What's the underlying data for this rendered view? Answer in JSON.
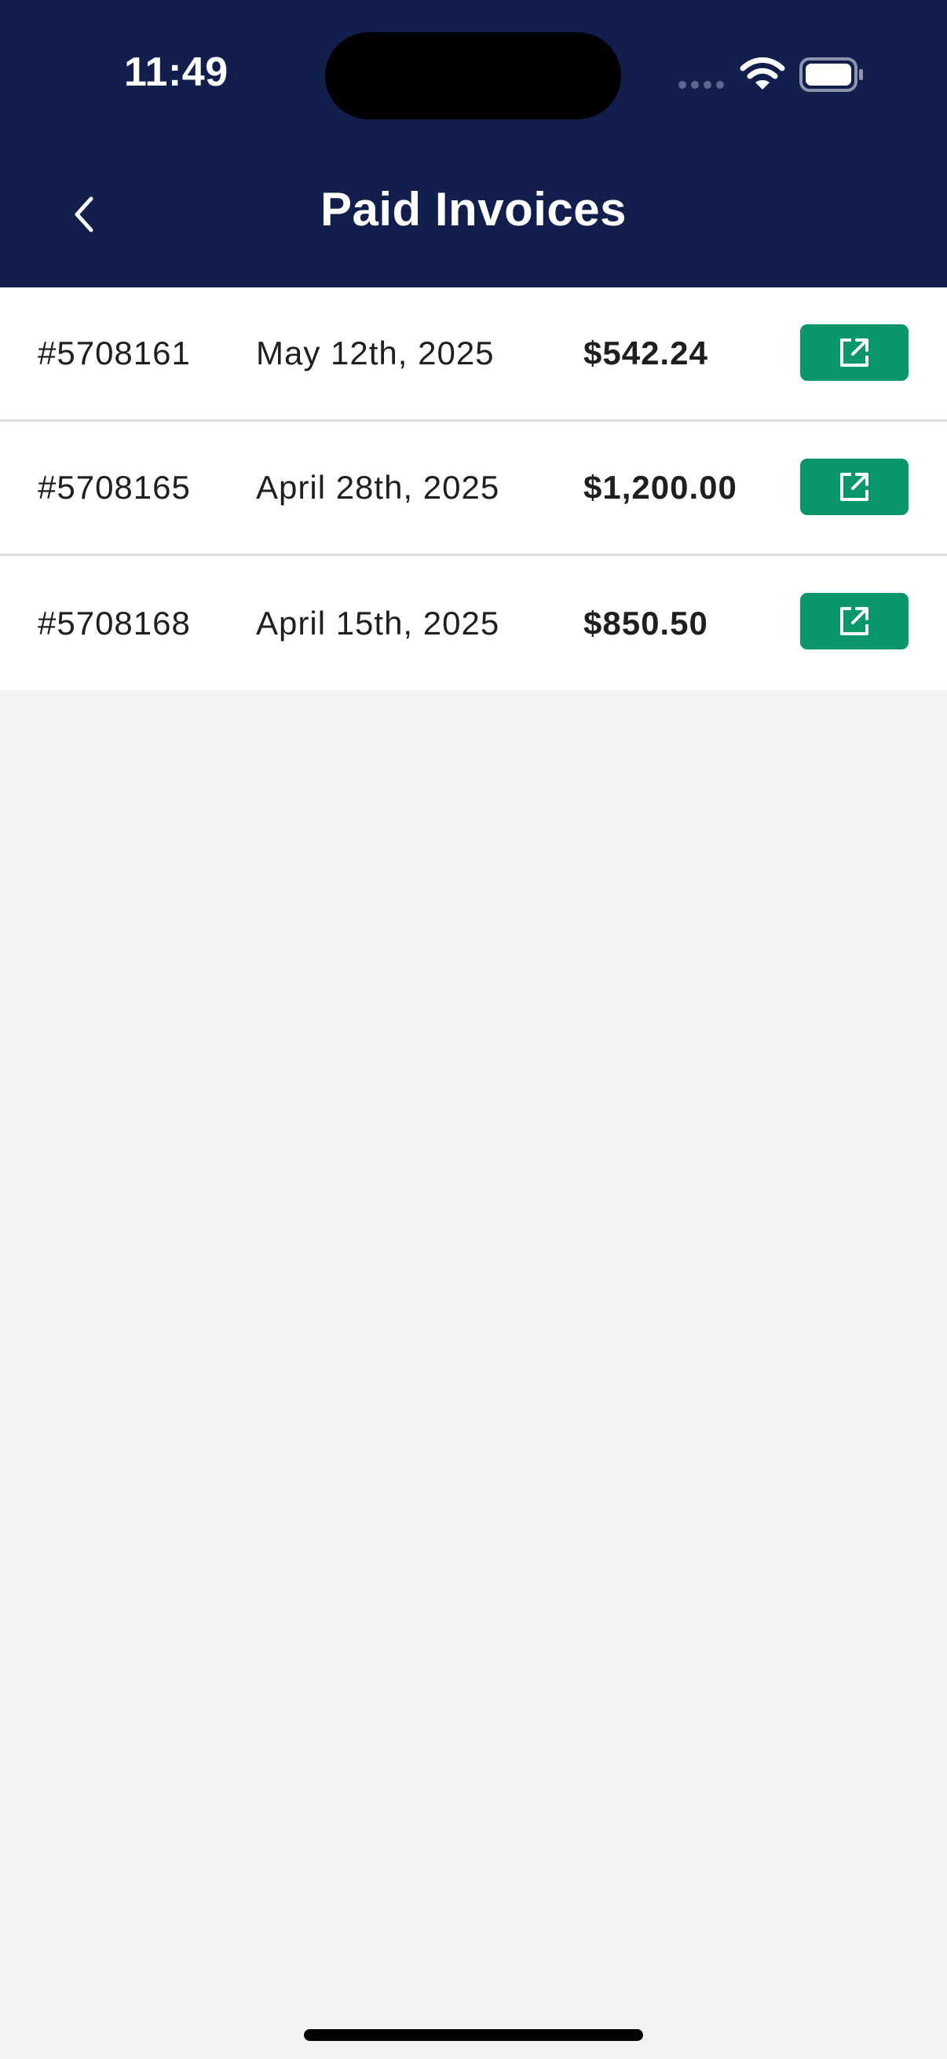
{
  "status_bar": {
    "time": "11:49"
  },
  "header": {
    "title": "Paid Invoices",
    "back_icon": "chevron-left-icon"
  },
  "invoices": [
    {
      "number": "#5708161",
      "date": "May 12th, 2025",
      "amount": "$542.24",
      "action_icon": "external-link-icon"
    },
    {
      "number": "#5708165",
      "date": "April 28th, 2025",
      "amount": "$1,200.00",
      "action_icon": "external-link-icon"
    },
    {
      "number": "#5708168",
      "date": "April 15th, 2025",
      "amount": "$850.50",
      "action_icon": "external-link-icon"
    }
  ],
  "colors": {
    "header_background": "#121e4b",
    "action_button": "#08966a",
    "page_background": "#f3f3f3"
  }
}
